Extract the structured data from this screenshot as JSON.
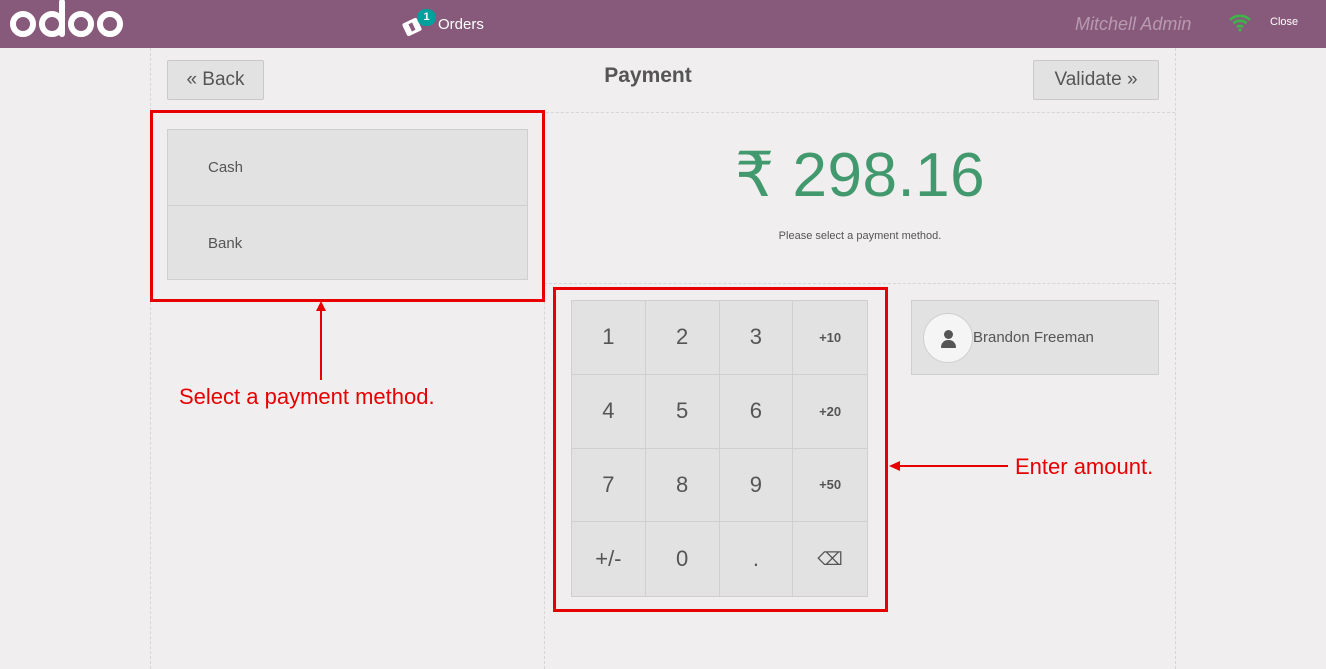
{
  "topbar": {
    "orders_count": "1",
    "orders_label": "Orders",
    "user": "Mitchell Admin",
    "close_label": "Close"
  },
  "header": {
    "back_label": "« Back",
    "title": "Payment",
    "validate_label": "Validate »"
  },
  "payment_methods": [
    "Cash",
    "Bank"
  ],
  "summary": {
    "amount": "₹ 298.16",
    "hint": "Please select a payment method."
  },
  "numpad": [
    "1",
    "2",
    "3",
    "+10",
    "4",
    "5",
    "6",
    "+20",
    "7",
    "8",
    "9",
    "+50",
    "+/-",
    "0",
    ".",
    "⌫"
  ],
  "customer": {
    "name": "Brandon Freeman"
  },
  "annotations": {
    "method": "Select a payment method.",
    "amount": "Enter amount."
  },
  "colors": {
    "topbar": "#875a7b",
    "amount": "#43996e",
    "badge": "#00a09d",
    "annotation": "#e60000"
  }
}
